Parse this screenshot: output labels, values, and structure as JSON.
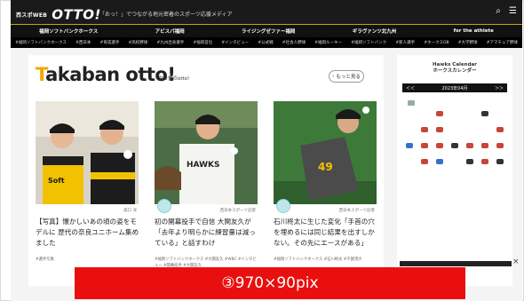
{
  "header": {
    "logo_small": "西スポWEB",
    "logo_big": "OTTO!",
    "tagline": "「おっ！」でつながる地元密着のスポーツ応援メディア"
  },
  "nav_primary": [
    "福岡ソフトバンクホークス",
    "アビスパ福岡",
    "ライジングゼファー福岡",
    "ギラヴァンツ北九州",
    "for the athlete"
  ],
  "nav_secondary": [
    "#福岡ソフトバンクホークス",
    "#西日本",
    "#育成選手",
    "#高校野球",
    "#九州出身選手",
    "#福岡首位",
    "#インタビュー",
    "#公式戦",
    "#社会人野球",
    "#福岡ルーキー",
    "#福岡ソフトバンク",
    "#新人選手",
    "#ホークスOB",
    "#大学野球",
    "#アマチュア野球"
  ],
  "section": {
    "title_first": "T",
    "title_rest": "akaban otto!",
    "subtitle": "タカ番のotto!",
    "more_label": "もっと見る"
  },
  "cards": [
    {
      "author": "森口 洋",
      "title": "【写真】懐かしいあの頃の姿をモデルに 歴代の奈良ユニホーム集めました",
      "tags": "#選手写真"
    },
    {
      "author": "西日本スポーツ記者",
      "title": "初の開幕投手で自信 大関友久が「去年より明らかに練習量は減っている」と話すわけ",
      "tags": "#福岡ソフトバンクホークス #大関友久 #WBC #インタビュー #開幕投手 #大関友久"
    },
    {
      "author": "西日本スポーツ記者",
      "title": "石川柊太に生じた変化「手首の穴を埋めるには同じ結果を出すしかない。その先にエースがある」",
      "tags": "#福岡ソフトバンクホークス #石川柊太 #千賀滉大"
    }
  ],
  "calendar": {
    "title_en": "Hawks Calendar",
    "title_ja": "ホークスカレンダー",
    "month": "2023年04月",
    "prev": "＜＜",
    "next": "＞＞"
  },
  "banner": {
    "text": "③970×90pix"
  },
  "close_label": "×",
  "colors": {
    "accent": "#f0a800",
    "banner_red": "#ea0f0f",
    "header_bg": "#1a1a1a"
  }
}
